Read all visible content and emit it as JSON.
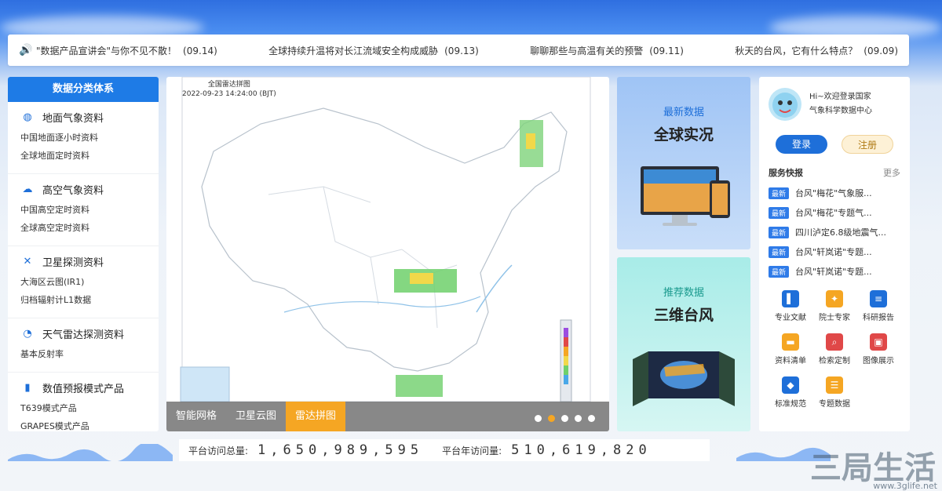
{
  "ticker": {
    "items": [
      {
        "text": "\"数据产品宣讲会\"与你不见不散！",
        "date": "(09.14)"
      },
      {
        "text": "全球持续升温将对长江流域安全构成威胁",
        "date": "(09.13)"
      },
      {
        "text": "聊聊那些与高温有关的预警",
        "date": "(09.11)"
      },
      {
        "text": "秋天的台风，它有什么特点？",
        "date": "(09.09)"
      }
    ]
  },
  "left": {
    "title": "数据分类体系",
    "categories": [
      {
        "title": "地面气象资料",
        "icon": "globe-icon",
        "subs": [
          "中国地面逐小时资料",
          "全球地面定时资料"
        ]
      },
      {
        "title": "高空气象资料",
        "icon": "cloud-icon",
        "subs": [
          "中国高空定时资料",
          "全球高空定时资料"
        ]
      },
      {
        "title": "卫星探测资料",
        "icon": "satellite-icon",
        "subs": [
          "大海区云图(IR1)",
          "归档辐射计L1数据"
        ]
      },
      {
        "title": "天气雷达探测资料",
        "icon": "radar-icon",
        "subs": [
          "基本反射率"
        ]
      },
      {
        "title": "数值预报模式产品",
        "icon": "chart-icon",
        "subs": [
          "T639模式产品",
          "GRAPES模式产品"
        ]
      }
    ]
  },
  "map": {
    "title_line1": "全国雷达拼图",
    "title_line2": "2022-09-23 14:24:00 (BJT)",
    "tabs": [
      "智能网格",
      "卫星云图",
      "雷达拼图"
    ],
    "active_tab": 2,
    "active_dot": 1
  },
  "promo": {
    "card1": {
      "label": "最新数据",
      "title": "全球实况"
    },
    "card2": {
      "label": "推荐数据",
      "title": "三维台风"
    }
  },
  "right": {
    "welcome_line1": "Hi~欢迎登录国家",
    "welcome_line2": "气象科学数据中心",
    "login": "登录",
    "register": "注册",
    "quick_title": "服务快报",
    "more": "更多",
    "quick_tag": "最新",
    "quick": [
      "台风\"梅花\"气象服...",
      "台风\"梅花\"专题气...",
      "四川泸定6.8级地震气...",
      "台风\"轩岚诺\"专题...",
      "台风\"轩岚诺\"专题..."
    ],
    "grid": [
      {
        "label": "专业文献",
        "icon": "book-icon",
        "color": "#1e6fd9"
      },
      {
        "label": "院士专家",
        "icon": "expert-icon",
        "color": "#f5a623"
      },
      {
        "label": "科研报告",
        "icon": "report-icon",
        "color": "#1e6fd9"
      },
      {
        "label": "资料清单",
        "icon": "folder-icon",
        "color": "#f5a623"
      },
      {
        "label": "检索定制",
        "icon": "search-icon",
        "color": "#e04848"
      },
      {
        "label": "图像展示",
        "icon": "image-icon",
        "color": "#e04848"
      },
      {
        "label": "标准规范",
        "icon": "shield-icon",
        "color": "#1e6fd9"
      },
      {
        "label": "专题数据",
        "icon": "layers-icon",
        "color": "#f5a623"
      }
    ]
  },
  "counter": {
    "total_label": "平台访问总量:",
    "total": "1,650,989,595",
    "year_label": "平台年访问量:",
    "year": "510,619,820"
  },
  "watermark": {
    "text": "三局生活",
    "url": "www.3glife.net"
  },
  "colors": {
    "primary": "#1e6fd9",
    "accent": "#f5a623"
  }
}
